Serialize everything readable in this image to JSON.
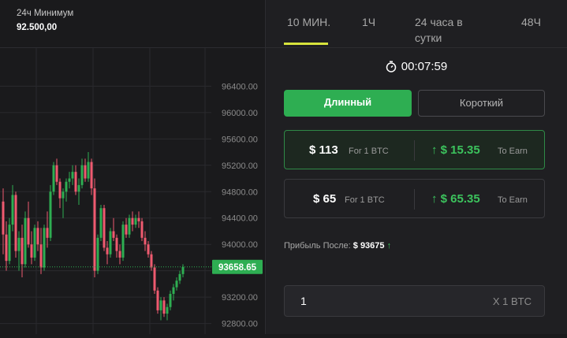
{
  "stats": {
    "label": "24ч Минимум",
    "value": "92.500,00"
  },
  "tabs": [
    {
      "label": "10 МИН.",
      "active": true
    },
    {
      "label": "1Ч",
      "active": false
    },
    {
      "label": "24 часа в сутки",
      "active": false
    },
    {
      "label": "48Ч",
      "active": false
    }
  ],
  "timer": "00:07:59",
  "trade": {
    "long_label": "Длинный",
    "short_label": "Короткий"
  },
  "options": [
    {
      "price": "$ 113",
      "for": "For 1 BTC",
      "earn": "$ 15.35",
      "earn_label": "To Earn",
      "selected": true
    },
    {
      "price": "$ 65",
      "for": "For 1 BTC",
      "earn": "$ 65.35",
      "earn_label": "To Earn",
      "selected": false
    }
  ],
  "profit": {
    "label": "Прибыль После:",
    "value": "$ 93675"
  },
  "quantity": {
    "value": "1",
    "unit": "X 1 BTC"
  },
  "chart_data": {
    "type": "candlestick",
    "yticks": [
      "96400.00",
      "96000.00",
      "95600.00",
      "95200.00",
      "94800.00",
      "94400.00",
      "94000.00",
      "93600.00",
      "93200.00",
      "92800.00"
    ],
    "current_price": "93658.65",
    "ylim": [
      92700,
      96500
    ],
    "colors": {
      "up": "#2eae52",
      "down": "#ef5a6f",
      "current": "#2eae52"
    },
    "candles": [
      [
        94650,
        94850,
        93850,
        94150
      ],
      [
        94150,
        94350,
        93600,
        93750
      ],
      [
        93750,
        94400,
        93700,
        94300
      ],
      [
        94300,
        94900,
        94200,
        94750
      ],
      [
        94750,
        94800,
        93800,
        93900
      ],
      [
        93900,
        94200,
        93600,
        94100
      ],
      [
        94100,
        94300,
        93500,
        93700
      ],
      [
        93700,
        94500,
        93650,
        94400
      ],
      [
        94400,
        94650,
        93950,
        94000
      ],
      [
        94000,
        94200,
        93700,
        93800
      ],
      [
        93800,
        94300,
        93750,
        94250
      ],
      [
        94250,
        94350,
        93900,
        94000
      ],
      [
        94000,
        94250,
        93550,
        93650
      ],
      [
        93650,
        94300,
        93600,
        94250
      ],
      [
        94250,
        94500,
        93950,
        94100
      ],
      [
        94100,
        94900,
        94050,
        94800
      ],
      [
        94800,
        95250,
        94750,
        95200
      ],
      [
        95200,
        95300,
        94900,
        94950
      ],
      [
        94950,
        95000,
        94550,
        94700
      ],
      [
        94700,
        94850,
        94400,
        94800
      ],
      [
        94800,
        95000,
        94650,
        94950
      ],
      [
        94950,
        95100,
        94850,
        95000
      ],
      [
        95000,
        95200,
        94900,
        95100
      ],
      [
        95100,
        95200,
        94750,
        94800
      ],
      [
        94800,
        95000,
        94600,
        94900
      ],
      [
        94900,
        95300,
        94850,
        95200
      ],
      [
        95200,
        95300,
        94950,
        95000
      ],
      [
        95000,
        95400,
        94950,
        95250
      ],
      [
        95250,
        95300,
        94750,
        94850
      ],
      [
        94850,
        95000,
        93500,
        93600
      ],
      [
        93600,
        94150,
        93550,
        94100
      ],
      [
        94100,
        94600,
        94050,
        94550
      ],
      [
        94550,
        94600,
        93900,
        93950
      ],
      [
        93950,
        94050,
        93700,
        93850
      ],
      [
        93850,
        94250,
        93800,
        94200
      ],
      [
        94200,
        94400,
        94050,
        94100
      ],
      [
        94100,
        94150,
        93800,
        93900
      ],
      [
        93900,
        94000,
        93700,
        93800
      ],
      [
        93800,
        94350,
        93750,
        94300
      ],
      [
        94300,
        94400,
        94100,
        94150
      ],
      [
        94150,
        94450,
        94100,
        94400
      ],
      [
        94400,
        94500,
        94200,
        94300
      ],
      [
        94300,
        94450,
        94250,
        94400
      ],
      [
        94400,
        94500,
        94250,
        94350
      ],
      [
        94350,
        94400,
        94050,
        94100
      ],
      [
        94100,
        94200,
        93900,
        94000
      ],
      [
        94000,
        94050,
        93800,
        93850
      ],
      [
        93850,
        93900,
        93600,
        93650
      ],
      [
        93650,
        93700,
        93250,
        93300
      ],
      [
        93300,
        93350,
        92950,
        93000
      ],
      [
        93000,
        93200,
        92850,
        93150
      ],
      [
        93150,
        93200,
        92900,
        92950
      ],
      [
        92950,
        93100,
        92850,
        93050
      ],
      [
        93050,
        93300,
        93000,
        93250
      ],
      [
        93250,
        93400,
        93150,
        93350
      ],
      [
        93350,
        93500,
        93300,
        93450
      ],
      [
        93450,
        93600,
        93400,
        93550
      ],
      [
        93550,
        93700,
        93500,
        93658
      ]
    ]
  }
}
